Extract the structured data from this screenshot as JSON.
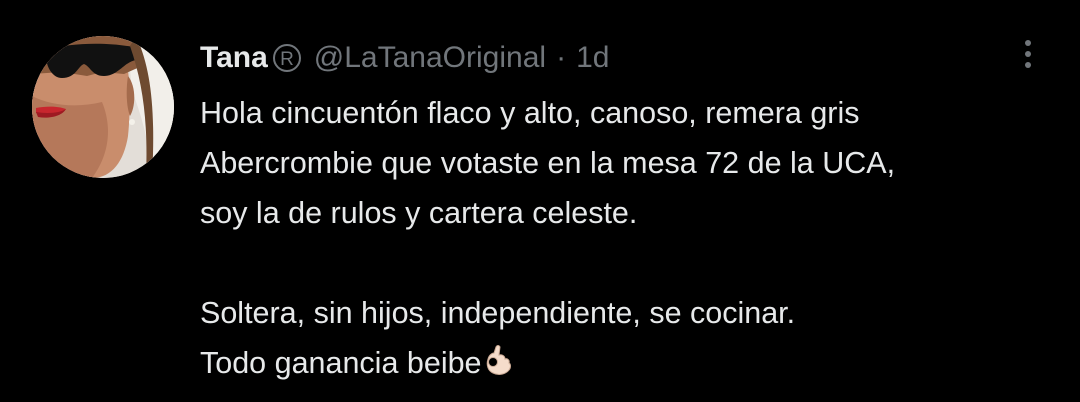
{
  "tweet": {
    "author_name": "Tana",
    "author_handle": "@LaTanaOriginal",
    "separator": "·",
    "timestamp": "1d",
    "verified_badge": "registered-r-icon",
    "more_icon": "more-vertical-icon",
    "lines": [
      "Hola cincuentón flaco y alto, canoso, remera gris",
      "Abercrombie que votaste en la mesa 72 de la UCA,",
      "soy la de rulos y cartera celeste.",
      "",
      "Soltera, sin hijos, independiente, se cocinar.",
      "Todo ganancia beibe"
    ],
    "emoji": "ok-hand-emoji"
  },
  "colors": {
    "background": "#000000",
    "text_primary": "#e7e9ea",
    "text_secondary": "#71767b"
  }
}
